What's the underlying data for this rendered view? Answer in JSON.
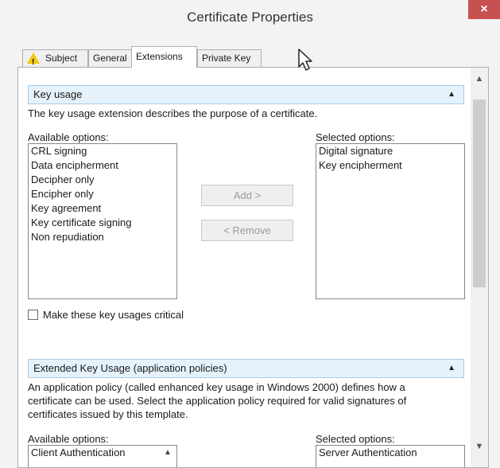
{
  "window": {
    "title": "Certificate Properties",
    "close_glyph": "×"
  },
  "tabs": [
    "Subject",
    "General",
    "Extensions",
    "Private Key"
  ],
  "key_usage": {
    "header": "Key usage",
    "description": "The key usage extension describes the purpose of a certificate.",
    "available_label": "Available options:",
    "available_options": [
      "CRL signing",
      "Data encipherment",
      "Decipher only",
      "Encipher only",
      "Key agreement",
      "Key certificate signing",
      "Non repudiation"
    ],
    "selected_label": "Selected options:",
    "selected_options": [
      "Digital signature",
      "Key encipherment"
    ],
    "add_button": "Add >",
    "remove_button": "< Remove",
    "critical_label": "Make these key usages critical"
  },
  "eku": {
    "header": "Extended Key Usage (application policies)",
    "description_lines": [
      "An application policy (called enhanced key usage in Windows 2000) defines how a",
      "certificate can be used. Select the application policy required for valid signatures of",
      "certificates issued by this template."
    ],
    "available_label": "Available options:",
    "available_first": "Client Authentication",
    "selected_label": "Selected options:",
    "selected_first": "Server Authentication"
  }
}
